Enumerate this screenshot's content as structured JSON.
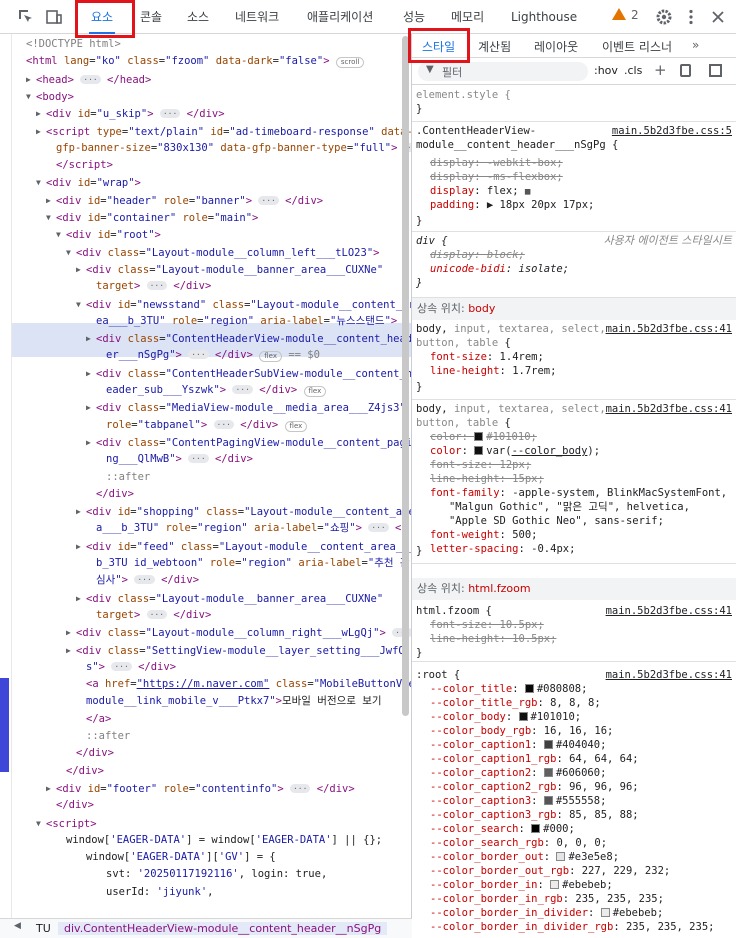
{
  "toolbar": {
    "tabs": [
      "요소",
      "콘솔",
      "소스",
      "네트워크",
      "애플리케이션",
      "성능",
      "메모리",
      "Lighthouse"
    ],
    "warning_count": "2",
    "active_tab": "요소"
  },
  "elements": {
    "lines": [
      {
        "i": 0,
        "t": "",
        "h": "<span class='cm'>&lt;!DOCTYPE html&gt;</span>"
      },
      {
        "i": 0,
        "t": "",
        "h": "<span class='tg'>&lt;html</span> <span class='an'>lang</span>=<span class='av'>\"ko\"</span> <span class='an'>class</span>=<span class='av'>\"fzoom\"</span> <span class='an'>data-dark</span>=<span class='av'>\"false\"</span><span class='tg'>&gt;</span> <span class='badge'>scroll</span>"
      },
      {
        "i": 1,
        "t": "▶",
        "h": "<span class='tg'>&lt;head&gt;</span> <span class='dots'>···</span> <span class='tg'>&lt;/head&gt;</span>"
      },
      {
        "i": 1,
        "t": "▼",
        "h": "<span class='tg'>&lt;body&gt;</span>"
      },
      {
        "i": 2,
        "t": "▶",
        "h": "<span class='tg'>&lt;div</span> <span class='an'>id</span>=<span class='av'>\"u_skip\"</span><span class='tg'>&gt;</span> <span class='dots'>···</span> <span class='tg'>&lt;/div&gt;</span>"
      },
      {
        "i": 2,
        "t": "▶",
        "h": "<span class='tg'>&lt;script</span> <span class='an'>type</span>=<span class='av'>\"text/plain\"</span> <span class='an'>id</span>=<span class='av'>\"ad-timeboard-response\"</span> <span class='an'>data-</span>"
      },
      {
        "i": 3,
        "t": "",
        "h": "<span class='an'>gfp-banner-size</span>=<span class='av'>\"830x130\"</span> <span class='an'>data-gfp-banner-type</span>=<span class='av'>\"full\"</span><span class='tg'>&gt;</span> <span class='dots'>···</span>"
      },
      {
        "i": 3,
        "t": "",
        "h": "<span class='tg'>&lt;/script&gt;</span>"
      },
      {
        "i": 2,
        "t": "▼",
        "h": "<span class='tg'>&lt;div</span> <span class='an'>id</span>=<span class='av'>\"wrap\"</span><span class='tg'>&gt;</span>"
      },
      {
        "i": 3,
        "t": "▶",
        "h": "<span class='tg'>&lt;div</span> <span class='an'>id</span>=<span class='av'>\"header\"</span> <span class='an'>role</span>=<span class='av'>\"banner\"</span><span class='tg'>&gt;</span> <span class='dots'>···</span> <span class='tg'>&lt;/div&gt;</span>"
      },
      {
        "i": 3,
        "t": "▼",
        "h": "<span class='tg'>&lt;div</span> <span class='an'>id</span>=<span class='av'>\"container\"</span> <span class='an'>role</span>=<span class='av'>\"main\"</span><span class='tg'>&gt;</span>"
      },
      {
        "i": 4,
        "t": "▼",
        "h": "<span class='tg'>&lt;div</span> <span class='an'>id</span>=<span class='av'>\"root\"</span><span class='tg'>&gt;</span>"
      },
      {
        "i": 5,
        "t": "▼",
        "h": "<span class='tg'>&lt;div</span> <span class='an'>class</span>=<span class='av'>\"Layout-module__column_left___tLO23\"</span><span class='tg'>&gt;</span>"
      },
      {
        "i": 6,
        "t": "▶",
        "h": "<span class='tg'>&lt;div</span> <span class='an'>class</span>=<span class='av'>\"Layout-module__banner_area___CUXNe\"</span>"
      },
      {
        "i": 7,
        "t": "",
        "h": "<span class='an'>target</span><span class='tg'>&gt;</span> <span class='dots'>···</span> <span class='tg'>&lt;/div&gt;</span>"
      },
      {
        "i": 6,
        "t": "▼",
        "h": "<span class='tg'>&lt;div</span> <span class='an'>id</span>=<span class='av'>\"newsstand\"</span> <span class='an'>class</span>=<span class='av'>\"Layout-module__content_ar</span>"
      },
      {
        "i": 7,
        "t": "",
        "h": "<span class='av'>ea___b_3TU\"</span> <span class='an'>role</span>=<span class='av'>\"region\"</span> <span class='an'>aria-label</span>=<span class='av'>\"뉴스스탠드\"</span><span class='tg'>&gt;</span>"
      },
      {
        "i": 7,
        "t": "▶",
        "h": "<span class='tg'>&lt;div</span> <span class='an'>class</span>=<span class='av'>\"ContentHeaderView-module__content_head</span>"
      },
      {
        "i": 8,
        "t": "",
        "h": "<span class='av'>er___nSgPg\"</span><span class='tg'>&gt;</span> <span class='dots'>···</span> <span class='tg'>&lt;/div&gt;</span> <span class='badge'>flex</span> <span class='cm'>== $0</span>"
      },
      {
        "i": 7,
        "t": "▶",
        "h": "<span class='tg'>&lt;div</span> <span class='an'>class</span>=<span class='av'>\"ContentHeaderSubView-module__content_h</span>"
      },
      {
        "i": 8,
        "t": "",
        "h": "<span class='av'>eader_sub___Yszwk\"</span><span class='tg'>&gt;</span> <span class='dots'>···</span> <span class='tg'>&lt;/div&gt;</span> <span class='badge'>flex</span>"
      },
      {
        "i": 7,
        "t": "▶",
        "h": "<span class='tg'>&lt;div</span> <span class='an'>class</span>=<span class='av'>\"MediaView-module__media_area___Z4js3\"</span>"
      },
      {
        "i": 8,
        "t": "",
        "h": "<span class='an'>role</span>=<span class='av'>\"tabpanel\"</span><span class='tg'>&gt;</span> <span class='dots'>···</span> <span class='tg'>&lt;/div&gt;</span> <span class='badge'>flex</span>"
      },
      {
        "i": 7,
        "t": "▶",
        "h": "<span class='tg'>&lt;div</span> <span class='an'>class</span>=<span class='av'>\"ContentPagingView-module__content_pagi</span>"
      },
      {
        "i": 8,
        "t": "",
        "h": "<span class='av'>ng___QlMwB\"</span><span class='tg'>&gt;</span> <span class='dots'>···</span> <span class='tg'>&lt;/div&gt;</span>"
      },
      {
        "i": 8,
        "t": "",
        "h": "<span class='cm'>::after</span>"
      },
      {
        "i": 7,
        "t": "",
        "h": "<span class='tg'>&lt;/div&gt;</span>"
      },
      {
        "i": 6,
        "t": "▶",
        "h": "<span class='tg'>&lt;div</span> <span class='an'>id</span>=<span class='av'>\"shopping\"</span> <span class='an'>class</span>=<span class='av'>\"Layout-module__content_area</span>"
      },
      {
        "i": 7,
        "t": "",
        "h": "<span class='av'>a___b_3TU\"</span> <span class='an'>role</span>=<span class='av'>\"region\"</span> <span class='an'>aria-label</span>=<span class='av'>\"쇼핑\"</span><span class='tg'>&gt;</span> <span class='dots'>···</span> <span class='tg'>&lt;/</span>"
      },
      {
        "i": 6,
        "t": "▶",
        "h": "<span class='tg'>&lt;div</span> <span class='an'>id</span>=<span class='av'>\"feed\"</span> <span class='an'>class</span>=<span class='av'>\"Layout-module__content_area___</span>"
      },
      {
        "i": 7,
        "t": "",
        "h": "<span class='av'>b_3TU id_webtoon\"</span> <span class='an'>role</span>=<span class='av'>\"region\"</span> <span class='an'>aria-label</span>=<span class='av'>\"추천 관</span>"
      },
      {
        "i": 7,
        "t": "",
        "h": "<span class='av'>심사\"</span><span class='tg'>&gt;</span> <span class='dots'>···</span> <span class='tg'>&lt;/div&gt;</span>"
      },
      {
        "i": 6,
        "t": "▶",
        "h": "<span class='tg'>&lt;div</span> <span class='an'>class</span>=<span class='av'>\"Layout-module__banner_area___CUXNe\"</span>"
      },
      {
        "i": 7,
        "t": "",
        "h": "<span class='an'>target</span><span class='tg'>&gt;</span> <span class='dots'>···</span> <span class='tg'>&lt;/div&gt;</span>"
      },
      {
        "i": 5,
        "t": "▶",
        "h": "<span class='tg'>&lt;div</span> <span class='an'>class</span>=<span class='av'>\"Layout-module__column_right___wLgQj\"</span><span class='tg'>&gt;</span> <span class='dots'>···</span>"
      },
      {
        "i": 5,
        "t": "▶",
        "h": "<span class='tg'>&lt;div</span> <span class='an'>class</span>=<span class='av'>\"SettingView-module__layer_setting___JwfQ</span>"
      },
      {
        "i": 6,
        "t": "",
        "h": "<span class='av'>s\"</span><span class='tg'>&gt;</span> <span class='dots'>···</span> <span class='tg'>&lt;/div&gt;</span>"
      },
      {
        "i": 6,
        "t": "",
        "h": "<span class='tg'>&lt;a</span> <span class='an'>href</span>=<span class='av' style='text-decoration:underline'>\"https://m.naver.com\"</span> <span class='an'>class</span>=<span class='av'>\"MobileButtonView-</span>"
      },
      {
        "i": 6,
        "t": "",
        "h": "<span class='av'>module__link_mobile_v___Ptkx7\"</span><span class='tg'>&gt;</span>모바일 버전으로 보기"
      },
      {
        "i": 6,
        "t": "",
        "h": "<span class='tg'>&lt;/a&gt;</span>"
      },
      {
        "i": 6,
        "t": "",
        "h": "<span class='cm'>::after</span>"
      },
      {
        "i": 5,
        "t": "",
        "h": "<span class='tg'>&lt;/div&gt;</span>"
      },
      {
        "i": 4,
        "t": "",
        "h": "<span class='tg'>&lt;/div&gt;</span>"
      },
      {
        "i": 3,
        "t": "▶",
        "h": "<span class='tg'>&lt;div</span> <span class='an'>id</span>=<span class='av'>\"footer\"</span> <span class='an'>role</span>=<span class='av'>\"contentinfo\"</span><span class='tg'>&gt;</span> <span class='dots'>···</span> <span class='tg'>&lt;/div&gt;</span>"
      },
      {
        "i": 3,
        "t": "",
        "h": "<span class='tg'>&lt;/div&gt;</span>"
      },
      {
        "i": 2,
        "t": "▼",
        "h": "<span class='tg'>&lt;script&gt;</span>"
      },
      {
        "i": 4,
        "t": "",
        "h": "window[<span class='av'>'EAGER-DATA'</span>] = window[<span class='av'>'EAGER-DATA'</span>] || {};"
      },
      {
        "i": 6,
        "t": "",
        "h": "window[<span class='av'>'EAGER-DATA'</span>][<span class='av'>'GV'</span>] = {"
      },
      {
        "i": 8,
        "t": "",
        "h": "svt: <span class='av'>'20250117192116'</span>,  login: true,"
      },
      {
        "i": 8,
        "t": "",
        "h": "userId: <span class='av'>'jiyunk'</span>,"
      }
    ]
  },
  "breadcrumb": {
    "items": [
      "TU",
      "div.ContentHeaderView-module__content_header__nSgPg"
    ]
  },
  "styles": {
    "subtabs": [
      "스타일",
      "계산됨",
      "레이아웃",
      "이벤트 리스너"
    ],
    "filter_placeholder": "필터",
    "hov": ":hov",
    "cls": ".cls",
    "element_style": "element.style {",
    "close": "}",
    "rule1_selector": ".ContentHeaderView-",
    "rule1_selector2": "module__content_header___nSgPg {",
    "rule1_src": "main.5b2d3fbe.css:5",
    "rule1_props": [
      {
        "h": "<span class='strike'>display: -webkit-box;</span>"
      },
      {
        "h": "<span class='strike'>display: -ms-flexbox;</span>"
      },
      {
        "h": "<span class='pname'>display</span>: flex; <span style='font-size:9px'>▦</span>"
      },
      {
        "h": "<span class='pname'>padding</span>: ▶ 18px 20px 17px;"
      }
    ],
    "ua_selector": "div {",
    "ua_src": "사용자 에이전트 스타일시트",
    "ua_props": [
      {
        "h": "<span class='strike'>display: block;</span>"
      },
      {
        "h": "<span style='font-style:italic'><span class='pname'>unicode-bidi</span>: isolate;</span>"
      }
    ],
    "inherit1_label": "상속 위치:",
    "inherit1_target": "body",
    "rule2_selector": "body, <span class='ua'>input, textarea, select,</span>",
    "rule2_selector2": "<span class='ua'>button, table</span> {",
    "rule2_src": "main.5b2d3fbe.css:41",
    "rule2_props": [
      {
        "h": "<span class='pname'>font-size</span>: 1.4rem;"
      },
      {
        "h": "<span class='pname'>line-height</span>: 1.7rem;"
      }
    ],
    "rule3_selector": "body, <span class='ua'>input, textarea, select,</span>",
    "rule3_selector2": "<span class='ua'>button, table</span> {",
    "rule3_src": "main.5b2d3fbe.css:41",
    "rule3_props": [
      {
        "h": "<span class='strike'>color: <span class='sw' style='background:#101010'></span>#101010;</span>"
      },
      {
        "h": "<span class='pname'>color</span>: <span class='sw' style='background:#101010'></span>var(<span style='text-decoration:underline'>--color_body</span>);"
      },
      {
        "h": "<span class='strike'>font-size: 12px;</span>"
      },
      {
        "h": "<span class='strike'>line-height: 15px;</span>"
      },
      {
        "h": "<span class='pname'>font-family</span>: -apple-system, BlinkMacSystemFont,"
      },
      {
        "h": "&nbsp;&nbsp;&nbsp;\"Malgun Gothic\", \"맑은 고딕\", helvetica,"
      },
      {
        "h": "&nbsp;&nbsp;&nbsp;\"Apple SD Gothic Neo\", sans-serif;"
      },
      {
        "h": "<span class='pname'>font-weight</span>: 500;"
      },
      {
        "h": "<span class='pname'>letter-spacing</span>: -0.4px;"
      }
    ],
    "inherit2_label": "상속 위치:",
    "inherit2_target": "html.fzoom",
    "rule4_selector": "html.fzoom {",
    "rule4_src": "main.5b2d3fbe.css:41",
    "rule4_props": [
      {
        "h": "<span class='strike'>font-size: 10.5px;</span>"
      },
      {
        "h": "<span class='strike'>line-height: 10.5px;</span>"
      }
    ],
    "root_selector": ":root {",
    "root_src": "main.5b2d3fbe.css:41",
    "root_vars": [
      {
        "n": "--color_title",
        "v": "#080808",
        "c": "#080808"
      },
      {
        "n": "--color_title_rgb",
        "v": "8, 8, 8"
      },
      {
        "n": "--color_body",
        "v": "#101010",
        "c": "#101010"
      },
      {
        "n": "--color_body_rgb",
        "v": "16, 16, 16"
      },
      {
        "n": "--color_caption1",
        "v": "#404040",
        "c": "#404040"
      },
      {
        "n": "--color_caption1_rgb",
        "v": "64, 64, 64"
      },
      {
        "n": "--color_caption2",
        "v": "#606060",
        "c": "#606060"
      },
      {
        "n": "--color_caption2_rgb",
        "v": "96, 96, 96"
      },
      {
        "n": "--color_caption3",
        "v": "#555558",
        "c": "#555558"
      },
      {
        "n": "--color_caption3_rgb",
        "v": "85, 85, 88"
      },
      {
        "n": "--color_search",
        "v": "#000",
        "c": "#000000"
      },
      {
        "n": "--color_search_rgb",
        "v": "0, 0, 0"
      },
      {
        "n": "--color_border_out",
        "v": "#e3e5e8",
        "c": "#e3e5e8"
      },
      {
        "n": "--color_border_out_rgb",
        "v": "227, 229, 232"
      },
      {
        "n": "--color_border_in",
        "v": "#ebebeb",
        "c": "#ebebeb"
      },
      {
        "n": "--color_border_in_rgb",
        "v": "235, 235, 235"
      },
      {
        "n": "--color_border_in_divider",
        "v": "#ebebeb",
        "c": "#ebebeb"
      },
      {
        "n": "--color_border_in_divider_rgb",
        "v": "235, 235, 235"
      }
    ]
  }
}
